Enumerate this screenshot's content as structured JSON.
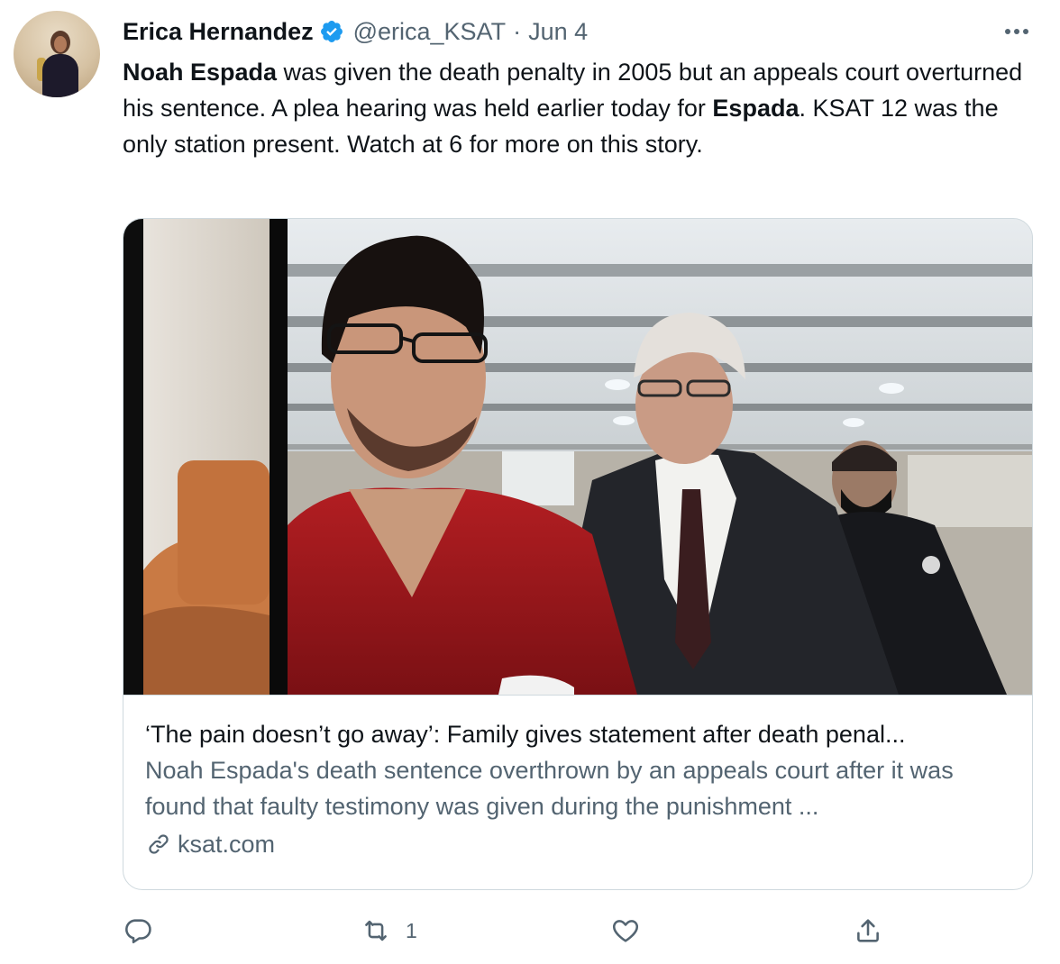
{
  "tweet": {
    "author": {
      "name": "Erica Hernandez",
      "handle": "@erica_KSAT",
      "verified": true
    },
    "separator": "·",
    "date": "Jun 4",
    "text": {
      "s1_bold": "Noah Espada",
      "s2": " was given the death penalty in 2005 but an appeals court overturned his sentence. A plea hearing was held earlier today for ",
      "s3_bold": "Espada",
      "s4": ". KSAT 12 was the only station present. Watch at 6 for more on this story."
    },
    "card": {
      "title": "‘The pain doesn’t go away’: Family gives statement after death penal...",
      "description": "Noah Espada's death sentence overthrown by an appeals court after it was found that faulty testimony was given during the punishment ...",
      "domain": "ksat.com"
    },
    "actions": {
      "reply_count": "",
      "retweet_count": "1",
      "like_count": "",
      "share_count": ""
    }
  },
  "colors": {
    "text_primary": "#0f1419",
    "text_secondary": "#536471",
    "verified_blue": "#1d9bf0",
    "border": "#cfd9de"
  },
  "icons": [
    "more-icon",
    "verified-badge-icon",
    "link-icon",
    "reply-icon",
    "retweet-icon",
    "like-icon",
    "share-icon"
  ]
}
